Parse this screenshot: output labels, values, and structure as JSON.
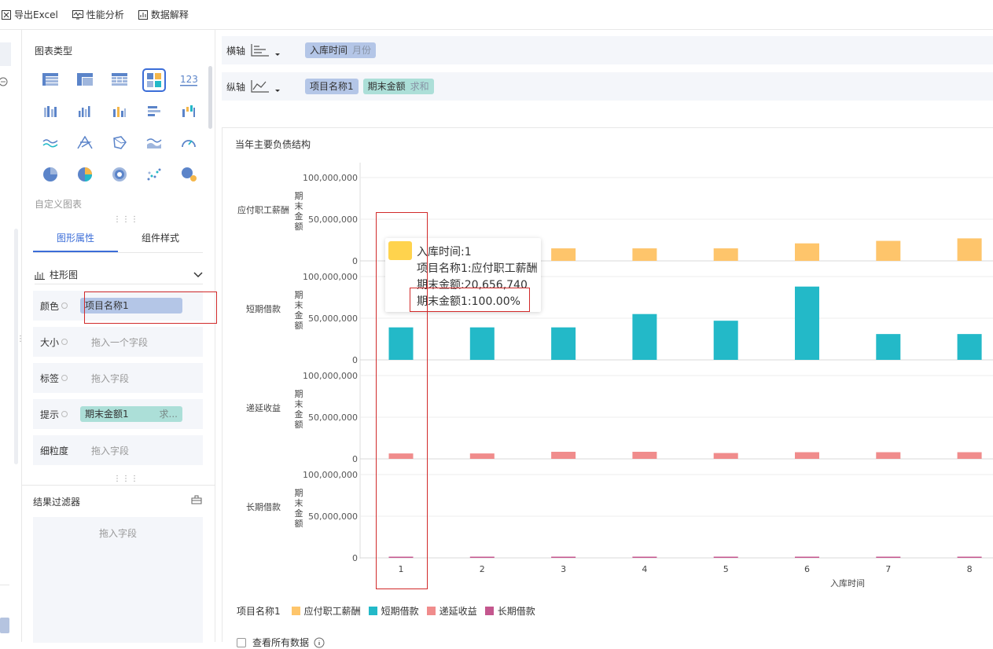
{
  "toolbar": {
    "export_excel": "导出Excel",
    "performance": "性能分析",
    "data_explain": "数据解释"
  },
  "panel": {
    "chart_type_title": "图表类型",
    "custom_chart": "自定义图表",
    "tabs": [
      "图形属性",
      "组件样式"
    ],
    "chart_kind": "柱形图",
    "props": [
      {
        "label": "颜色",
        "value": "项目名称1",
        "kind": "blue"
      },
      {
        "label": "大小",
        "value": "拖入一个字段",
        "kind": "placeholder"
      },
      {
        "label": "标签",
        "value": "拖入字段",
        "kind": "placeholder"
      },
      {
        "label": "提示",
        "value": "期末金额1",
        "extra": "求...",
        "kind": "teal"
      },
      {
        "label": "细粒度",
        "value": "拖入字段",
        "kind": "placeholder"
      }
    ],
    "filter_title": "结果过滤器",
    "filter_placeholder": "拖入字段"
  },
  "axes": {
    "x_label": "横轴",
    "y_label": "纵轴",
    "x_field": "入库时间",
    "x_field_sub": "月份",
    "y_field1": "项目名称1",
    "y_field2": "期末金额",
    "y_field2_sub": "求和"
  },
  "chart": {
    "title": "当年主要负债结构",
    "y_axis_title": "期末金额",
    "x_axis_title": "入库时间",
    "legend_title": "项目名称1",
    "show_all": "查看所有数据"
  },
  "chart_data": {
    "type": "bar",
    "title": "当年主要负债结构",
    "xlabel": "入库时间",
    "ylabel": "期末金额",
    "ylim": [
      0,
      100000000
    ],
    "yticks": [
      "0",
      "50,000,000",
      "100,000,000"
    ],
    "categories": [
      "1",
      "2",
      "3",
      "4",
      "5",
      "6",
      "7",
      "8"
    ],
    "series": [
      {
        "name": "应付职工薪酬",
        "color": "#fec56b",
        "values": [
          20656740,
          17000000,
          15000000,
          15000000,
          15000000,
          21000000,
          24000000,
          27000000
        ]
      },
      {
        "name": "短期借款",
        "color": "#23b9c8",
        "values": [
          39000000,
          39000000,
          39000000,
          55000000,
          47000000,
          88000000,
          31000000,
          31000000
        ]
      },
      {
        "name": "递延收益",
        "color": "#f08c8c",
        "values": [
          6500000,
          6500000,
          8500000,
          8500000,
          7000000,
          8000000,
          8000000,
          8000000
        ]
      },
      {
        "name": "长期借款",
        "color": "#c4578e",
        "values": [
          300000,
          300000,
          300000,
          300000,
          300000,
          300000,
          300000,
          300000
        ]
      }
    ]
  },
  "tooltip": {
    "line1": "入库时间:1",
    "line2": "项目名称1:应付职工薪酬",
    "line3": "期末金额:20,656,740",
    "line4": "期末金额1:100.00%"
  }
}
